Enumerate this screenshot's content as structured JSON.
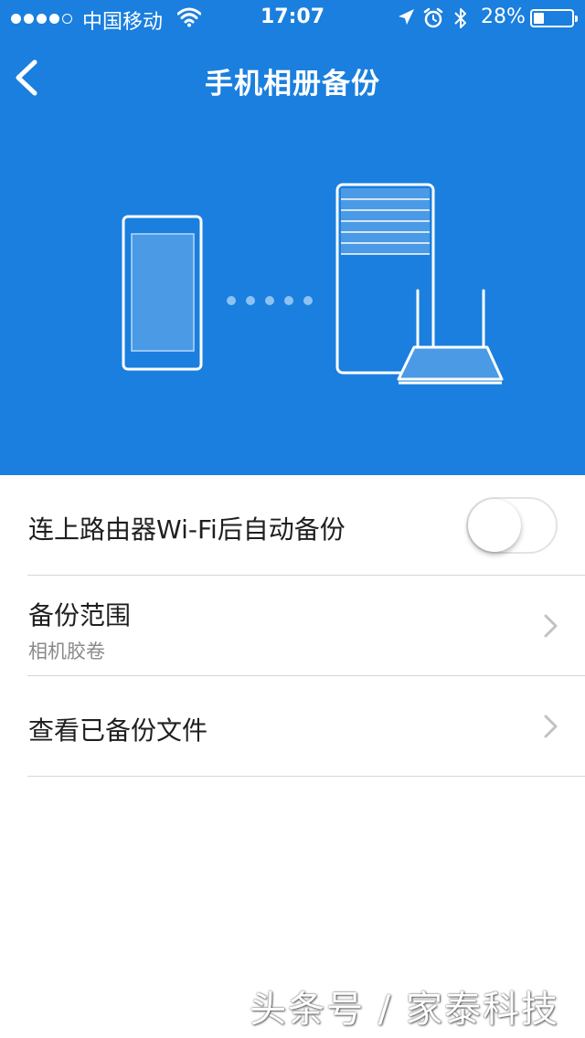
{
  "status_bar": {
    "carrier": "中国移动",
    "time": "17:07",
    "battery_percent": "28%",
    "battery_level": 0.28,
    "signal_bars_filled": 4,
    "signal_bars_total": 5,
    "icons": [
      "wifi-icon",
      "location-arrow-icon",
      "alarm-icon",
      "bluetooth-icon",
      "battery-icon"
    ]
  },
  "nav": {
    "title": "手机相册备份",
    "back_icon": "chevron-left-icon"
  },
  "hero": {
    "background_color": "#1a7fde",
    "illustration": [
      "phone-icon",
      "sync-dots-icon",
      "server-icon",
      "router-icon"
    ]
  },
  "settings": {
    "auto_backup": {
      "label": "连上路由器Wi-Fi后自动备份",
      "enabled": false
    },
    "backup_scope": {
      "label": "备份范围",
      "value": "相机胶卷"
    },
    "view_backups": {
      "label": "查看已备份文件"
    }
  },
  "watermark": "头条号 / 家泰科技"
}
